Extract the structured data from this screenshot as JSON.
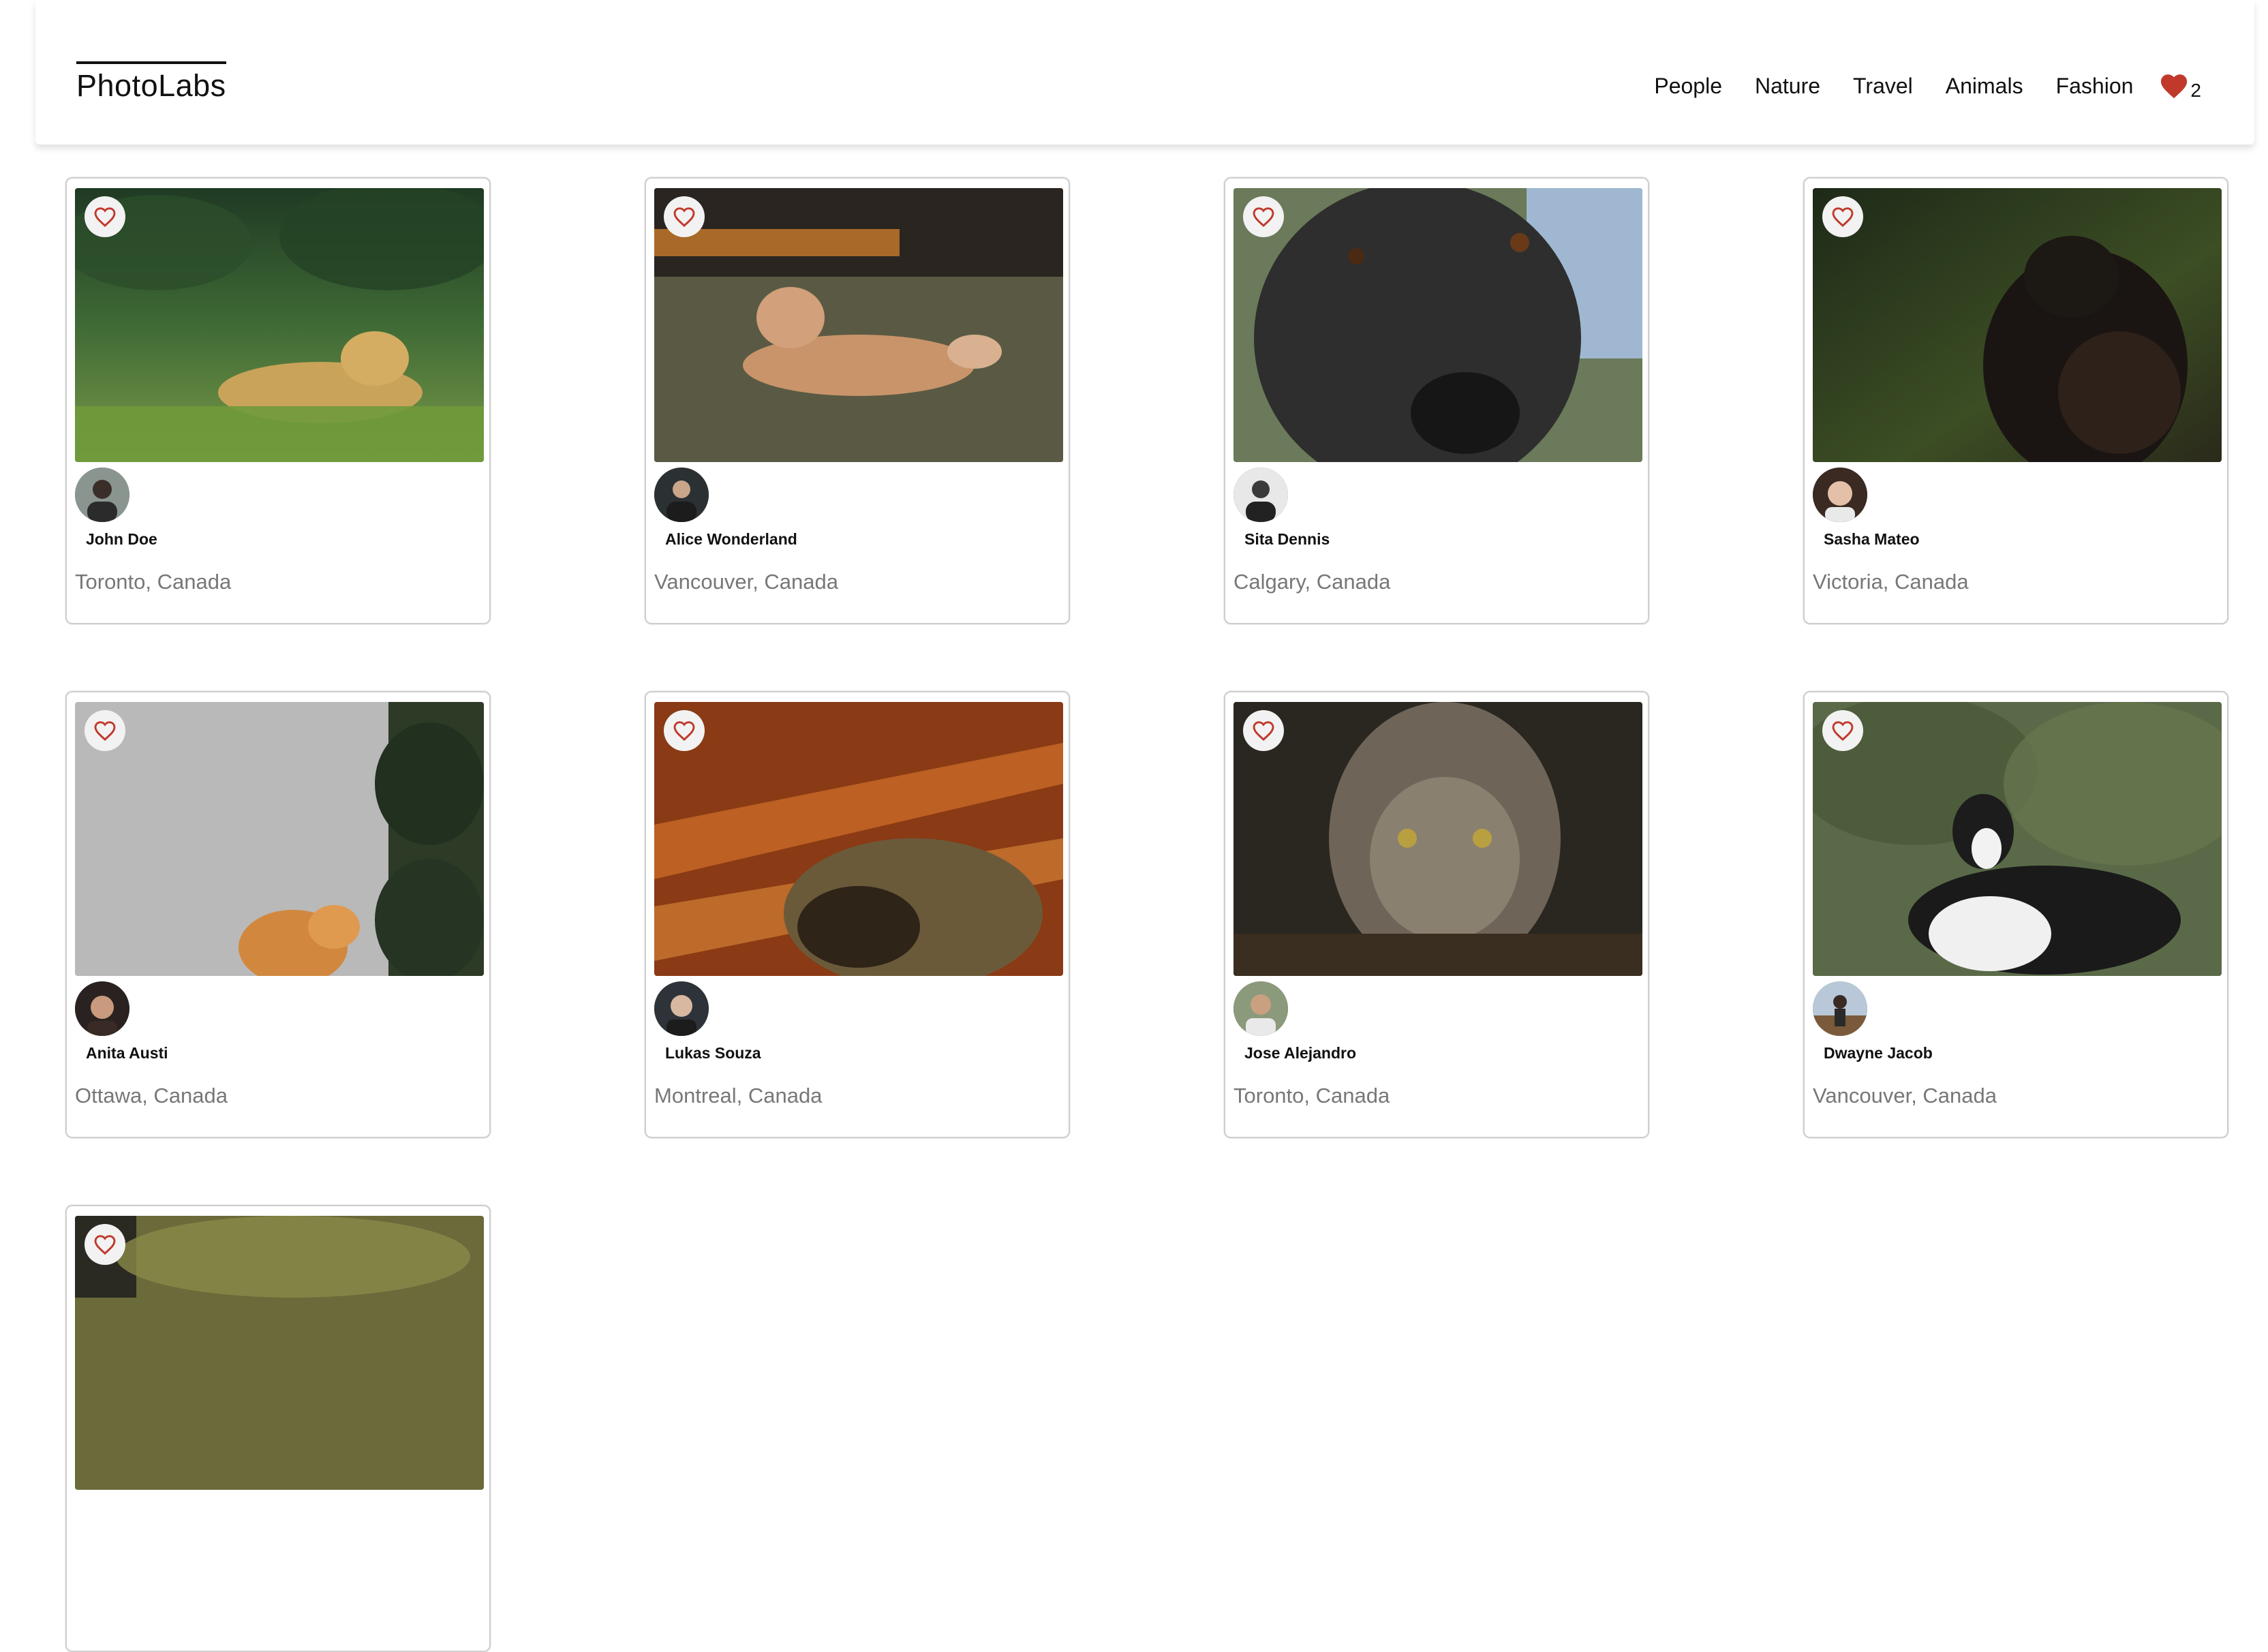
{
  "app": {
    "logo": "PhotoLabs"
  },
  "nav": {
    "topics": [
      "People",
      "Nature",
      "Travel",
      "Animals",
      "Fashion"
    ],
    "favorites_count": "2",
    "favorite_color": "#c0392b"
  },
  "photos": [
    {
      "user": "John Doe",
      "location": "Toronto, Canada",
      "subject": "jaguar"
    },
    {
      "user": "Alice Wonderland",
      "location": "Vancouver, Canada",
      "subject": "dog-lying"
    },
    {
      "user": "Sita Dennis",
      "location": "Calgary, Canada",
      "subject": "dog-closeup"
    },
    {
      "user": "Sasha Mateo",
      "location": "Victoria, Canada",
      "subject": "black-cat"
    },
    {
      "user": "Anita Austi",
      "location": "Ottawa, Canada",
      "subject": "orange-cat"
    },
    {
      "user": "Lukas Souza",
      "location": "Montreal, Canada",
      "subject": "cat-sleeping"
    },
    {
      "user": "Jose Alejandro",
      "location": "Toronto, Canada",
      "subject": "tabby-cat"
    },
    {
      "user": "Dwayne Jacob",
      "location": "Vancouver, Canada",
      "subject": "border-collie"
    },
    {
      "user": "",
      "location": "",
      "subject": "partial"
    }
  ]
}
